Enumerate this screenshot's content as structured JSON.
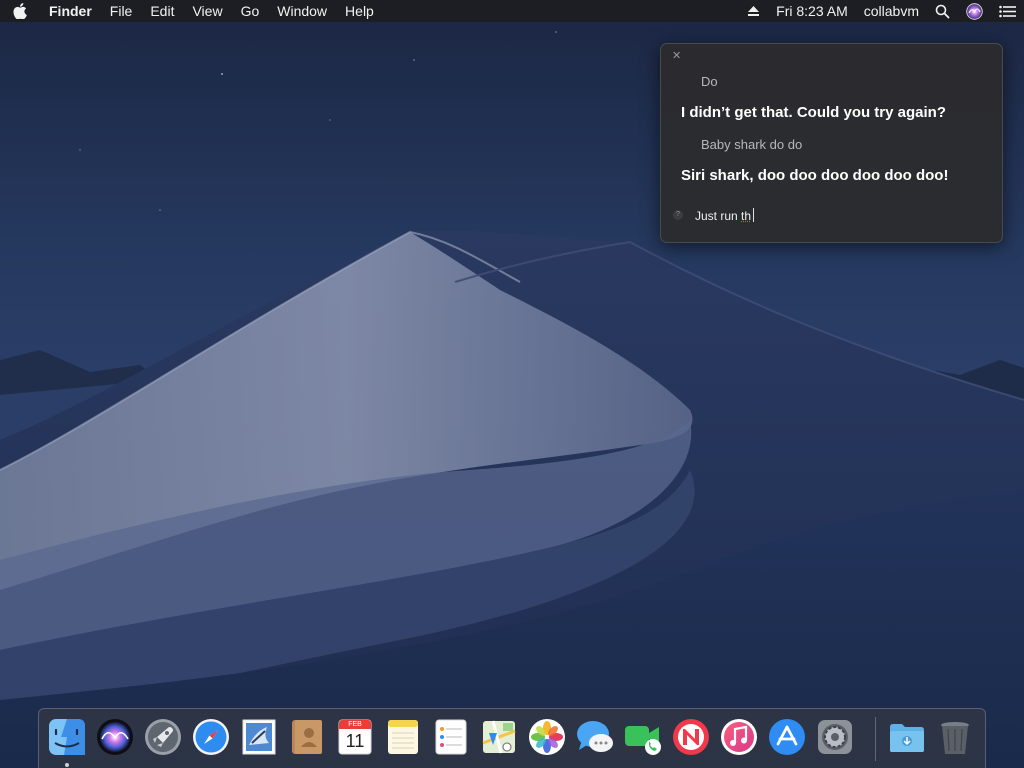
{
  "menubar": {
    "apple_icon": "apple-logo-icon",
    "app_name": "Finder",
    "menus": [
      "File",
      "Edit",
      "View",
      "Go",
      "Window",
      "Help"
    ],
    "status": {
      "eject_icon": "eject-icon",
      "clock": "Fri 8:23 AM",
      "user": "collabvm",
      "spotlight_icon": "search-icon",
      "siri_icon": "siri-icon",
      "notification_icon": "list-icon"
    }
  },
  "siri": {
    "close_icon": "close-icon",
    "conversation": [
      {
        "role": "user",
        "text": "Do"
      },
      {
        "role": "siri",
        "text": "I didn’t get that. Could you try again?"
      },
      {
        "role": "user",
        "text": "Baby shark do do"
      },
      {
        "role": "siri",
        "text": "Siri shark, doo doo doo doo doo doo!"
      }
    ],
    "input": {
      "help_icon": "question-icon",
      "prefix": "Just run ",
      "misspelled": "th"
    }
  },
  "dock": {
    "apps": [
      {
        "name": "Finder",
        "icon": "finder-icon",
        "running": true
      },
      {
        "name": "Siri",
        "icon": "siri-icon",
        "running": false
      },
      {
        "name": "Launchpad",
        "icon": "rocket-icon",
        "running": false
      },
      {
        "name": "Safari",
        "icon": "compass-icon",
        "running": false
      },
      {
        "name": "Mail",
        "icon": "mail-stamp-icon",
        "running": false
      },
      {
        "name": "Contacts",
        "icon": "contacts-book-icon",
        "running": false
      },
      {
        "name": "Calendar",
        "icon": "calendar-icon",
        "running": false,
        "month": "FEB",
        "day": "11"
      },
      {
        "name": "Notes",
        "icon": "notes-icon",
        "running": false
      },
      {
        "name": "Reminders",
        "icon": "reminders-icon",
        "running": false
      },
      {
        "name": "Maps",
        "icon": "map-icon",
        "running": false
      },
      {
        "name": "Photos",
        "icon": "photos-flower-icon",
        "running": false
      },
      {
        "name": "Messages",
        "icon": "chat-bubble-icon",
        "running": false
      },
      {
        "name": "FaceTime",
        "icon": "video-camera-icon",
        "running": false
      },
      {
        "name": "News",
        "icon": "news-icon",
        "running": false
      },
      {
        "name": "iTunes",
        "icon": "music-note-icon",
        "running": false
      },
      {
        "name": "App Store",
        "icon": "app-store-icon",
        "running": false
      },
      {
        "name": "System Preferences",
        "icon": "gear-icon",
        "running": false
      },
      {
        "name": "Downloads",
        "icon": "downloads-folder-icon",
        "running": false
      },
      {
        "name": "Trash",
        "icon": "trash-icon",
        "running": false
      }
    ]
  },
  "colors": {
    "menubar_bg": "#1e1e20",
    "siri_panel_bg": "#2c2c2e",
    "siri_response_text": "#ffffff",
    "user_text": "#b8b8bb",
    "desktop_sky": "#1a2540",
    "desktop_dune": "#2f4270"
  }
}
